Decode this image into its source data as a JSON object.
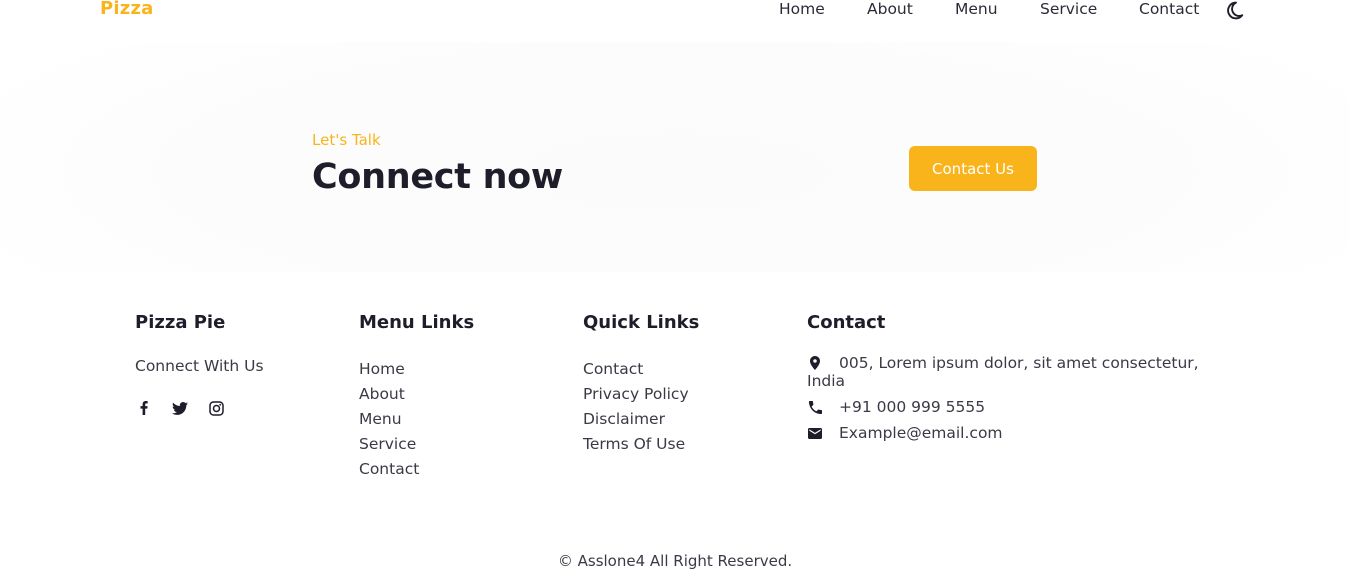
{
  "header": {
    "logo": "Pizza",
    "nav": [
      "Home",
      "About",
      "Menu",
      "Service",
      "Contact"
    ],
    "theme_icon": "moon-icon"
  },
  "cta": {
    "kicker": "Let's Talk",
    "title": "Connect now",
    "button_label": "Contact Us"
  },
  "footer": {
    "about": {
      "title": "Pizza Pie",
      "text": "Connect With Us",
      "socials": [
        "facebook-icon",
        "twitter-icon",
        "instagram-icon"
      ]
    },
    "menu_links": {
      "title": "Menu Links",
      "items": [
        "Home",
        "About",
        "Menu",
        "Service",
        "Contact"
      ]
    },
    "quick_links": {
      "title": "Quick Links",
      "items": [
        "Contact",
        "Privacy Policy",
        "Disclaimer",
        "Terms Of Use"
      ]
    },
    "contact": {
      "title": "Contact",
      "address": "005, Lorem ipsum dolor, sit amet consectetur, India",
      "phone": "+91 000 999 5555",
      "email": "Example@email.com"
    },
    "copyright": "© Asslone4 All Right Reserved."
  },
  "colors": {
    "accent": "#f9b41b",
    "text_dark": "#1e1d2a",
    "text_body": "#3a3a46",
    "background": "#ffffff"
  }
}
